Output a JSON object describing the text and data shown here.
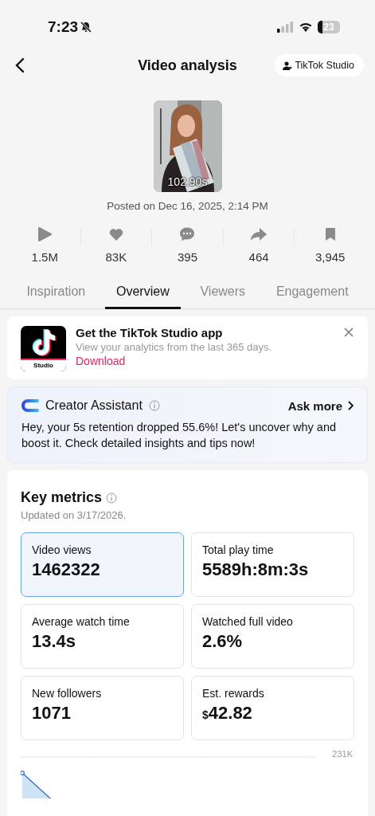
{
  "status_bar": {
    "time": "7:23",
    "battery": "23"
  },
  "header": {
    "title": "Video analysis",
    "studio_button": "TikTok Studio"
  },
  "video": {
    "duration": "102.90s",
    "posted": "Posted on Dec 16, 2025, 2:14 PM"
  },
  "stats": [
    {
      "kind": "play",
      "value": "1.5M"
    },
    {
      "kind": "like",
      "value": "83K"
    },
    {
      "kind": "comment",
      "value": "395"
    },
    {
      "kind": "share",
      "value": "464"
    },
    {
      "kind": "save",
      "value": "3,945"
    }
  ],
  "tabs": [
    {
      "label": "Inspiration",
      "selected": false
    },
    {
      "label": "Overview",
      "selected": true
    },
    {
      "label": "Viewers",
      "selected": false
    },
    {
      "label": "Engagement",
      "selected": false
    }
  ],
  "promo": {
    "logo_label": "Studio",
    "title": "Get the TikTok Studio app",
    "subtitle": "View your analytics from the last 365 days.",
    "link": "Download"
  },
  "assistant": {
    "title": "Creator Assistant",
    "action": "Ask more",
    "message": "Hey, your 5s retention dropped 55.6%! Let's uncover why and boost it. Check detailed insights and tips now!"
  },
  "key_metrics": {
    "title": "Key metrics",
    "updated": "Updated on 3/17/2026.",
    "metrics": [
      {
        "label": "Video views",
        "value": "1462322",
        "selected": true
      },
      {
        "label": "Total play time",
        "value": "5589h:8m:3s",
        "selected": false
      },
      {
        "label": "Average watch time",
        "value": "13.4s",
        "selected": false
      },
      {
        "label": "Watched full video",
        "value": "2.6%",
        "selected": false
      },
      {
        "label": "New followers",
        "value": "1071",
        "selected": false
      },
      {
        "label": "Est. rewards",
        "currency": "$",
        "value": "42.82",
        "selected": false
      }
    ],
    "chart_top_label": "231K"
  }
}
